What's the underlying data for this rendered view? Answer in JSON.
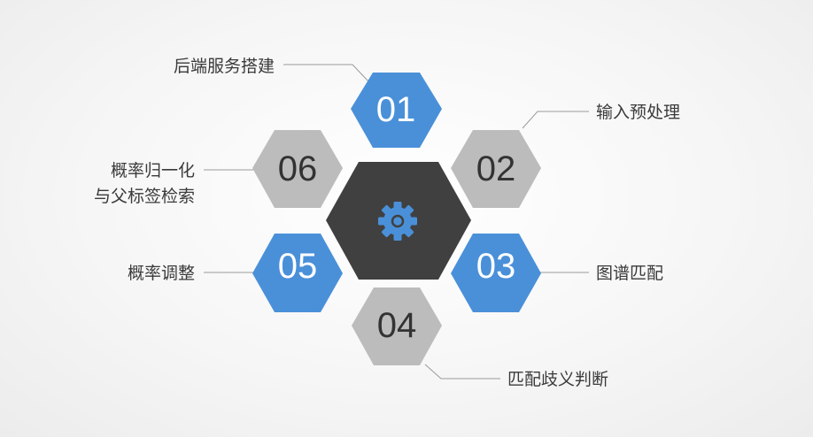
{
  "colors": {
    "blue": "#4a90d9",
    "gray": "#bcbcbc",
    "center": "#404040",
    "blue_text": "#ffffff",
    "gray_text": "#333333",
    "line": "#9a9a9a"
  },
  "center": {
    "icon": "gear-icon"
  },
  "steps": [
    {
      "num": "01",
      "label": "后端服务搭建",
      "style": "blue"
    },
    {
      "num": "02",
      "label": "输入预处理",
      "style": "gray"
    },
    {
      "num": "03",
      "label": "图谱匹配",
      "style": "blue"
    },
    {
      "num": "04",
      "label": "匹配歧义判断",
      "style": "gray"
    },
    {
      "num": "05",
      "label": "概率调整",
      "style": "blue"
    },
    {
      "num": "06",
      "label_line1": "概率归一化",
      "label_line2": "与父标签检索",
      "style": "gray"
    }
  ]
}
